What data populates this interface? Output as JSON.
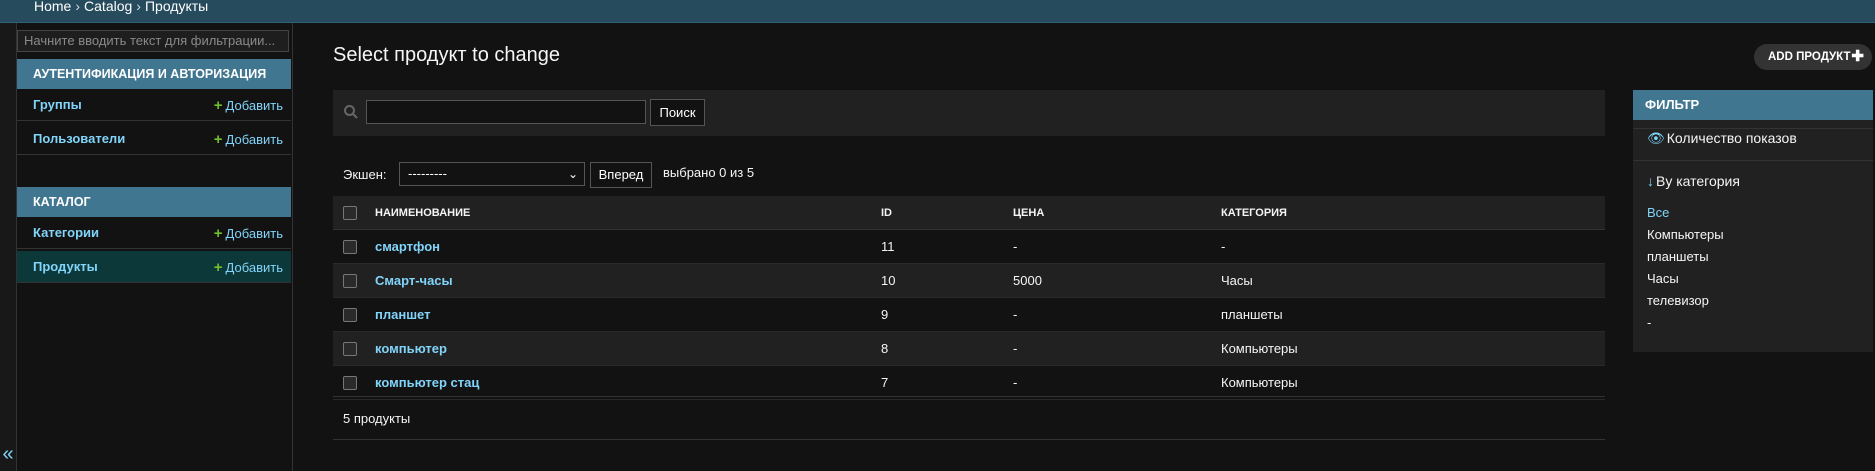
{
  "breadcrumbs": [
    "Home",
    "Catalog",
    "Продукты"
  ],
  "sidebar": {
    "filter_placeholder": "Начните вводить текст для фильтрации...",
    "modules": [
      {
        "caption": "Аутентификация и авторизация",
        "models": [
          {
            "name": "Группы",
            "add": "Добавить"
          },
          {
            "name": "Пользователи",
            "add": "Добавить"
          }
        ]
      },
      {
        "caption": "Каталог",
        "models": [
          {
            "name": "Категории",
            "add": "Добавить"
          },
          {
            "name": "Продукты",
            "add": "Добавить"
          }
        ]
      }
    ],
    "collapse_glyph": "«"
  },
  "content": {
    "title": "Select продукт to change",
    "add_button": "Add продукт",
    "search_button": "Поиск",
    "action_label": "Экшен:",
    "action_select_value": "---------",
    "go_button": "Вперед",
    "selection_counter": "выбрано 0 из 5",
    "columns": [
      "Наименование",
      "ID",
      "Цена",
      "Категория"
    ],
    "rows": [
      {
        "name": "смартфон",
        "id": "11",
        "price": "-",
        "category": "-"
      },
      {
        "name": "Смарт-часы",
        "id": "10",
        "price": "5000",
        "category": "Часы"
      },
      {
        "name": "планшет",
        "id": "9",
        "price": "-",
        "category": "планшеты"
      },
      {
        "name": "компьютер",
        "id": "8",
        "price": "-",
        "category": "Компьютеры"
      },
      {
        "name": "компьютер стац",
        "id": "7",
        "price": "-",
        "category": "Компьютеры"
      }
    ],
    "paginator": "5 продукты"
  },
  "filter": {
    "title": "Фильтр",
    "show_counts": "Количество показов",
    "by_category": "By категория",
    "options": [
      "Все",
      "Компьютеры",
      "планшеты",
      "Часы",
      "телевизор",
      "-"
    ]
  },
  "colors": {
    "header_bg": "#264b5d",
    "module_caption_bg": "#417690",
    "link": "#81d4fa",
    "add_plus": "#70bf2b",
    "selected_row_bg": "#0d3839"
  }
}
